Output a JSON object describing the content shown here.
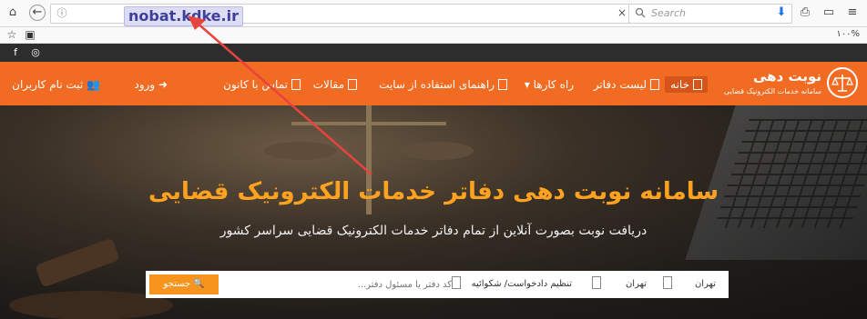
{
  "browser": {
    "url": "nobat.kdke.ir",
    "search_placeholder": "Search",
    "zoom_level": "۱۰۰%",
    "icons": [
      "home-icon",
      "back-icon",
      "info-icon",
      "clear-icon",
      "search-icon",
      "download-icon",
      "print-icon",
      "window-icon",
      "menu-icon",
      "star-icon",
      "clipboard-icon"
    ]
  },
  "site": {
    "logo": {
      "title": "نوبت دهی",
      "subtitle": "سامانه خدمات الکترونیک قضایی"
    },
    "nav": {
      "home": "خانه",
      "offices": "لیست دفاتر",
      "guides": "راه کارها",
      "usage_guide": "راهنمای استفاده از سایت",
      "articles": "مقالات",
      "contact": "تماس با کانون",
      "login": "ورود",
      "register": "ثبت نام کاربران"
    },
    "hero": {
      "title": "سامانه نوبت دهی دفاتر خدمات الکترونیک قضایی",
      "subtitle": "دریافت نوبت بصورت آنلاین از تمام دفاتر خدمات الکترونیک قضایی سراسر کشور"
    },
    "search": {
      "province": "تهران",
      "city": "تهران",
      "service": "تنظیم دادخواست/ شکوائیه",
      "office_placeholder": "کد دفتر یا مسئول دفتر...",
      "button": "جستجو"
    }
  },
  "colors": {
    "navbar": "#f26b22",
    "hero_title": "#ffa21f",
    "search_button": "#f7941d",
    "annotation": "#e8443d"
  }
}
